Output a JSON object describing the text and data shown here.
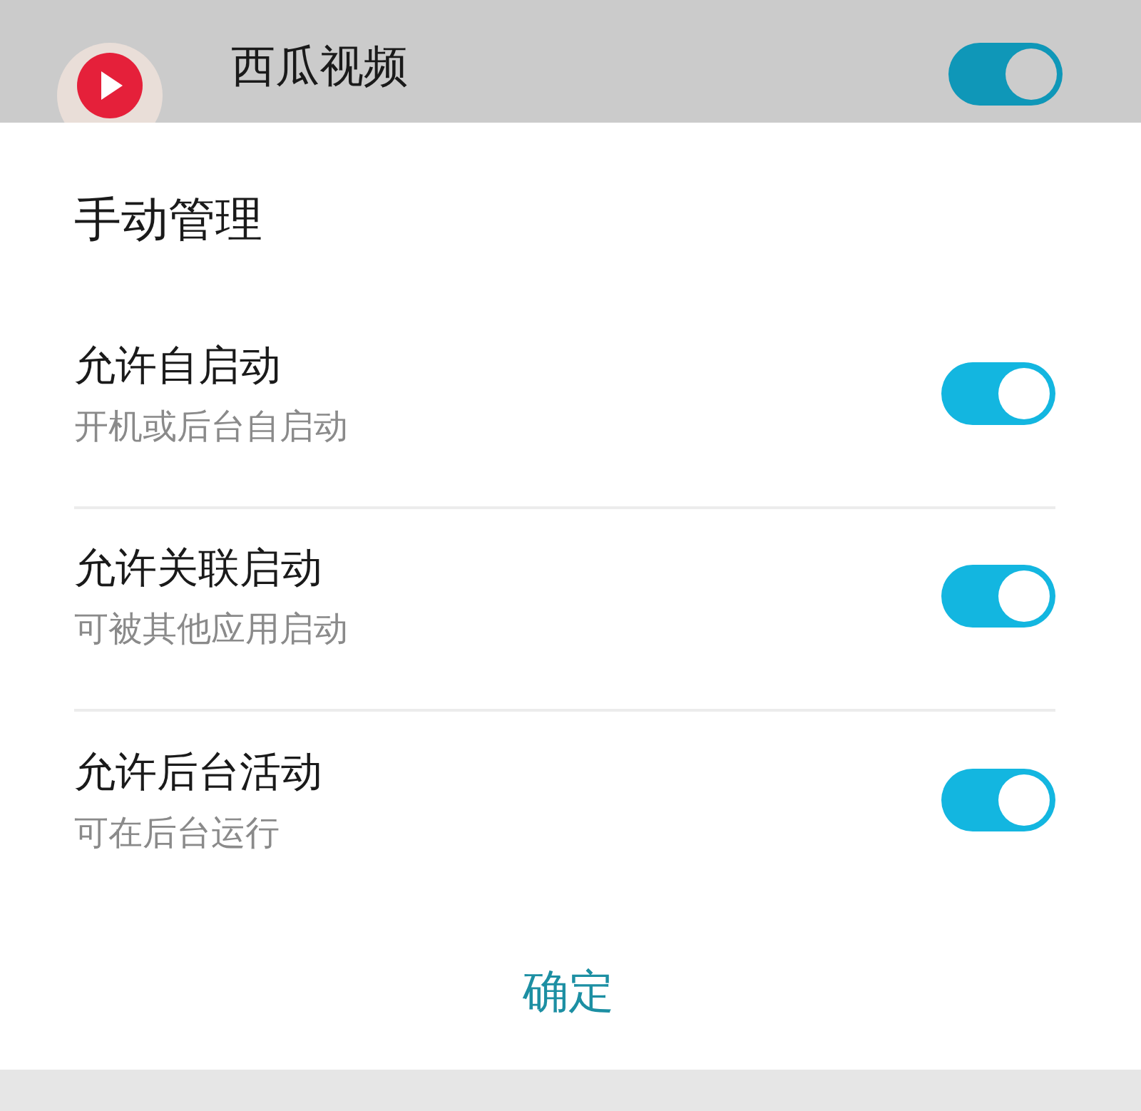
{
  "background_app": {
    "name": "西瓜视频",
    "on": true
  },
  "dialog": {
    "title": "手动管理",
    "options": [
      {
        "label": "允许自启动",
        "description": "开机或后台自启动",
        "on": true
      },
      {
        "label": "允许关联启动",
        "description": "可被其他应用启动",
        "on": true
      },
      {
        "label": "允许后台活动",
        "description": "可在后台运行",
        "on": true
      }
    ],
    "confirm": "确定"
  }
}
